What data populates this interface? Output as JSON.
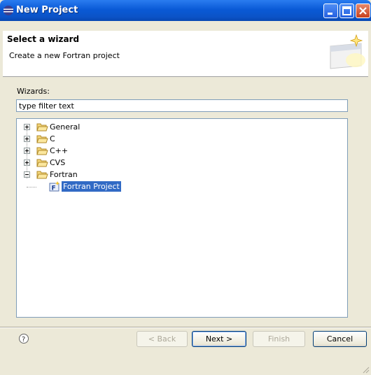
{
  "window": {
    "title": "New Project",
    "icon": "eclipse-icon"
  },
  "header": {
    "title": "Select a wizard",
    "description": "Create a new Fortran project",
    "banner_icon": "wizard-banner-icon"
  },
  "wizards": {
    "label": "Wizards:",
    "filter_value": "type filter text"
  },
  "tree": {
    "items": [
      {
        "label": "General",
        "expanded": false
      },
      {
        "label": "C",
        "expanded": false
      },
      {
        "label": "C++",
        "expanded": false
      },
      {
        "label": "CVS",
        "expanded": false
      },
      {
        "label": "Fortran",
        "expanded": true,
        "children": [
          {
            "label": "Fortran Project",
            "selected": true
          }
        ]
      }
    ]
  },
  "buttons": {
    "help": "help-icon",
    "back": "< Back",
    "next": "Next >",
    "finish": "Finish",
    "cancel": "Cancel"
  },
  "colors": {
    "titlebar": "#0a5ad6",
    "selection": "#316ac5",
    "dialog_bg": "#ece9d8"
  }
}
